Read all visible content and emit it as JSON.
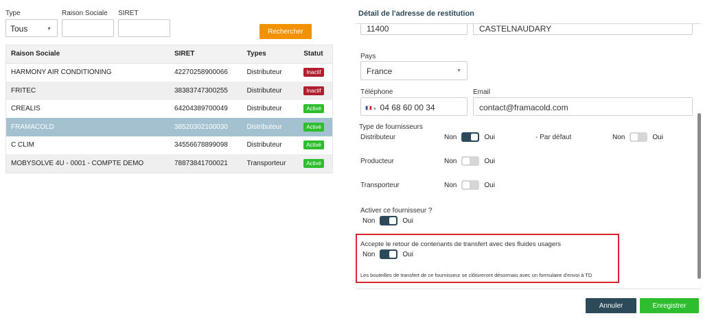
{
  "filters": {
    "type_label": "Type",
    "type_value": "Tous",
    "raison_label": "Raison Sociale",
    "raison_value": "",
    "siret_label": "SIRET",
    "siret_value": "",
    "search_button": "Rechercher"
  },
  "table": {
    "headers": [
      "Raison Sociale",
      "SIRET",
      "Types",
      "Statut"
    ],
    "rows": [
      {
        "name": "HARMONY AIR CONDITIONING",
        "siret": "42270258900066",
        "type": "Distributeur",
        "status": "Inactif"
      },
      {
        "name": "FRITEC",
        "siret": "38383747300255",
        "type": "Distributeur",
        "status": "Inactif"
      },
      {
        "name": "CREALIS",
        "siret": "64204389700049",
        "type": "Distributeur",
        "status": "Activé"
      },
      {
        "name": "FRAMACOLD",
        "siret": "38520302100030",
        "type": "Distributeur",
        "status": "Activé"
      },
      {
        "name": "C CLIM",
        "siret": "34556678899098",
        "type": "Distributeur",
        "status": "Activé"
      },
      {
        "name": "MOBYSOLVE 4U - 0001 - COMPTE DEMO",
        "siret": "78873841700021",
        "type": "Transporteur",
        "status": "Activé"
      }
    ]
  },
  "panel": {
    "title": "Détail de l'adresse de restitution",
    "postal_code": "11400",
    "city": "CASTELNAUDARY",
    "pays_label": "Pays",
    "pays_value": "France",
    "telephone_label": "Téléphone",
    "telephone_value": "04 68 60 00 34",
    "email_label": "Email",
    "email_value": "contact@framacold.com",
    "supplier_type_label": "Type de fournisseurs",
    "non": "Non",
    "oui": "Oui",
    "distributeur_label": "Distributeur",
    "par_defaut_label": "- Par défaut",
    "producteur_label": "Producteur",
    "transporteur_label": "Transporteur",
    "activate_label": "Activer ce fournisseur ?",
    "accept_label": "Accepte le retour de contenants de transfert avec des fluides usagers",
    "accept_note": "Les bouteilles de transfert de ce fournisseur se clôtureront désormais avec un formulaire d'envoi à TD"
  },
  "toggles": {
    "distributeur": true,
    "par_defaut": false,
    "producteur": false,
    "transporteur": false,
    "activer": true,
    "accepte": true
  },
  "buttons": {
    "cancel": "Annuler",
    "save": "Enregistrer"
  },
  "colors": {
    "accent_orange": "#f39200",
    "primary_dark": "#2d4a5a",
    "success_green": "#2ebd2e",
    "inactive_red": "#b01e2f",
    "highlight_red": "#d9232e",
    "selected_row": "#a3c1d1"
  }
}
